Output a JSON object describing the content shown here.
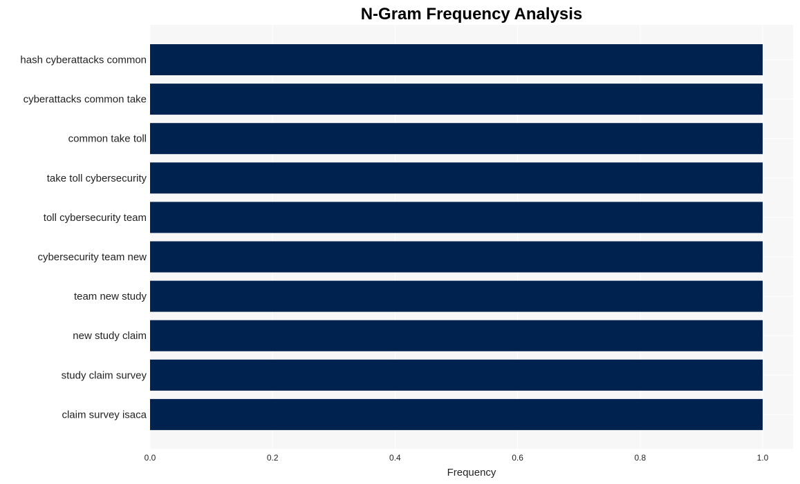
{
  "chart_data": {
    "type": "bar",
    "orientation": "horizontal",
    "title": "N-Gram Frequency Analysis",
    "xlabel": "Frequency",
    "ylabel": "",
    "categories": [
      "hash cyberattacks common",
      "cyberattacks common take",
      "common take toll",
      "take toll cybersecurity",
      "toll cybersecurity team",
      "cybersecurity team new",
      "team new study",
      "new study claim",
      "study claim survey",
      "claim survey isaca"
    ],
    "values": [
      1,
      1,
      1,
      1,
      1,
      1,
      1,
      1,
      1,
      1
    ],
    "xlim": [
      0,
      1.05
    ],
    "xticks": [
      "0.0",
      "0.2",
      "0.4",
      "0.6",
      "0.8",
      "1.0"
    ],
    "grid": true,
    "bar_color": "#00224e",
    "background_color": "#f7f7f7"
  }
}
